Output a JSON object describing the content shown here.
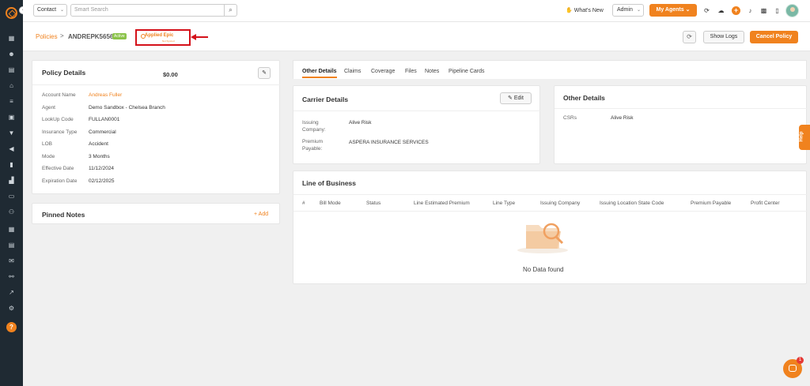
{
  "topbar": {
    "contact_select": "Contact",
    "search_placeholder": "Smart Search",
    "whats_new": "What's New",
    "admin_select": "Admin",
    "my_agents": "My Agents"
  },
  "breadcrumb": {
    "root": "Policies",
    "separator": ">",
    "policy_id": "ANDREPK5656",
    "status": "Active"
  },
  "integration": {
    "logo_text": "Applied Epic",
    "sub_text": "Not Synced"
  },
  "actions": {
    "show_logs": "Show Logs",
    "cancel_policy": "Cancel Policy"
  },
  "policy_details": {
    "title": "Policy Details",
    "amount": "$0.00",
    "fields": [
      {
        "label": "Account Name",
        "value": "Andreas Fuller"
      },
      {
        "label": "Agent",
        "value": "Demo Sandbox - Chelsea Branch"
      },
      {
        "label": "LookUp Code",
        "value": "FULLAN0001"
      },
      {
        "label": "Insurance Type",
        "value": "Commercial"
      },
      {
        "label": "LOB",
        "value": "Accident"
      },
      {
        "label": "Mode",
        "value": "3 Months"
      },
      {
        "label": "Effective Date",
        "value": "11/12/2024"
      },
      {
        "label": "Expiration Date",
        "value": "02/12/2025"
      }
    ]
  },
  "pinned_notes": {
    "title": "Pinned Notes",
    "add": "+ Add"
  },
  "tabs": [
    "Other Details",
    "Claims",
    "Coverage",
    "Files",
    "Notes",
    "Pipeline Cards"
  ],
  "carrier_details": {
    "title": "Carrier Details",
    "edit": "Edit",
    "issuing_label_1": "Issuing",
    "issuing_label_2": "Company:",
    "issuing_value": "Alive Risk",
    "premium_label_1": "Premium",
    "premium_label_2": "Payable:",
    "premium_value": "ASPERA INSURANCE SERVICES"
  },
  "other_details": {
    "title": "Other Details",
    "csrs_label": "CSRs",
    "csrs_value": "Alive Risk"
  },
  "line_of_business": {
    "title": "Line of Business",
    "columns": [
      "#",
      "Bill Mode",
      "Status",
      "Line Estimated Premium",
      "Line Type",
      "Issuing Company",
      "Issuing Location State Code",
      "Premium Payable",
      "Profit Center"
    ],
    "empty": "No Data found"
  },
  "help_tab": "Help",
  "chat_badge": "1",
  "colors": {
    "accent": "#f0821e",
    "sidebar": "#1f2a33",
    "highlight": "#d4111a",
    "active_badge": "#8bc34a"
  }
}
